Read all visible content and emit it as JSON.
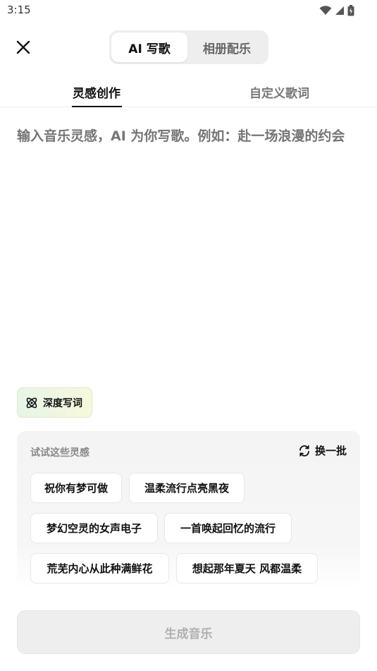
{
  "status_bar": {
    "time": "3:15",
    "icons": [
      "wifi-icon",
      "signal-icon",
      "battery-icon"
    ]
  },
  "header": {
    "close_icon": "close-icon",
    "segments": [
      {
        "label": "AI 写歌",
        "active": true
      },
      {
        "label": "相册配乐",
        "active": false
      }
    ]
  },
  "tabs": [
    {
      "label": "灵感创作",
      "active": true
    },
    {
      "label": "自定义歌词",
      "active": false
    }
  ],
  "prompt": {
    "value": "",
    "placeholder": "输入音乐灵感，AI 为你写歌。例如：赴一场浪漫的约会"
  },
  "deep_lyric": {
    "label": "深度写词",
    "icon": "atom-icon"
  },
  "inspiration": {
    "title": "试试这些灵感",
    "refresh_label": "换一批",
    "refresh_icon": "refresh-icon",
    "chips": [
      "祝你有梦可做",
      "温柔流行点亮黑夜",
      "梦幻空灵的女声电子",
      "一首唤起回忆的流行",
      "荒芜内心从此种满鲜花",
      "想起那年夏天 风都温柔"
    ]
  },
  "generate_button": {
    "label": "生成音乐",
    "enabled": false
  },
  "colors": {
    "accent_text": "#111111",
    "placeholder": "#b3b3b3",
    "disabled_button": "#eeeeee"
  }
}
